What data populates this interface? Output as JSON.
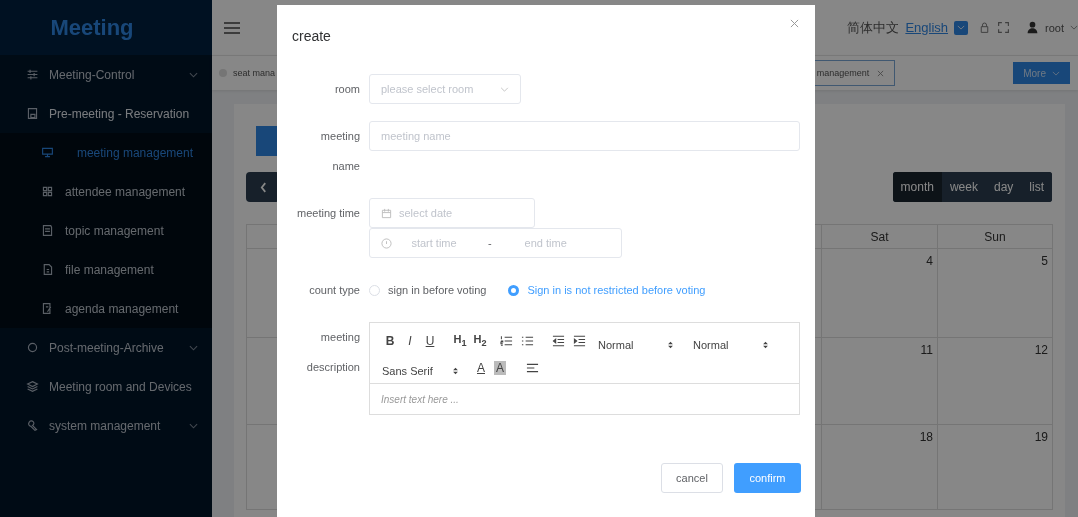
{
  "sidebar": {
    "logo": "Meeting",
    "items": [
      {
        "label": "Meeting-Control",
        "expanded": false
      },
      {
        "label": "Pre-meeting - Reservation",
        "expanded": true,
        "children": [
          {
            "label": "meeting management",
            "selected": true
          },
          {
            "label": "attendee management",
            "selected": false
          },
          {
            "label": "topic management",
            "selected": false
          },
          {
            "label": "file management",
            "selected": false
          },
          {
            "label": "agenda management",
            "selected": false
          }
        ]
      },
      {
        "label": "Post-meeting-Archive",
        "expanded": false
      },
      {
        "label": "Meeting room and Devices",
        "expanded": false
      },
      {
        "label": "system management",
        "expanded": false
      }
    ]
  },
  "header": {
    "languages": [
      {
        "label": "简体中文",
        "selected": false
      },
      {
        "label": "English",
        "selected": true
      }
    ],
    "user": "root"
  },
  "tags": [
    {
      "label": "seat mana",
      "selected": false
    },
    {
      "label": "management",
      "selected": true
    }
  ],
  "more_button": "More",
  "toolbar": {
    "views": [
      {
        "label": "month",
        "selected": true
      },
      {
        "label": "week",
        "selected": false
      },
      {
        "label": "day",
        "selected": false
      },
      {
        "label": "list",
        "selected": false
      }
    ]
  },
  "calendar": {
    "columns": [
      "Sat",
      "Sun"
    ],
    "rows": [
      [
        "4",
        "5"
      ],
      [
        "11",
        "12"
      ],
      [
        "18",
        "19"
      ]
    ]
  },
  "dialog": {
    "title": "create",
    "room": {
      "label": "room",
      "placeholder": "please select room"
    },
    "name": {
      "label": "meeting name",
      "placeholder": "meeting name"
    },
    "time": {
      "label": "meeting time",
      "date_placeholder": "select date",
      "start_placeholder": "start time",
      "separator": "-",
      "end_placeholder": "end time"
    },
    "count_type": {
      "label": "count type",
      "options": [
        {
          "label": "sign in before voting",
          "selected": false
        },
        {
          "label": "Sign in is not restricted before voting",
          "selected": true
        }
      ]
    },
    "description": {
      "label": "meeting description",
      "placeholder": "Insert text here ...",
      "toolbar": {
        "bold": "B",
        "italic": "I",
        "underline": "U",
        "header_1": "H$_{1}$",
        "header_2": "H$_{2}$",
        "size": "Normal",
        "header": "Normal",
        "font": "Sans Serif",
        "foreground": "A",
        "background": "A"
      }
    },
    "buttons": {
      "cancel": "cancel",
      "confirm": "confirm"
    }
  }
}
